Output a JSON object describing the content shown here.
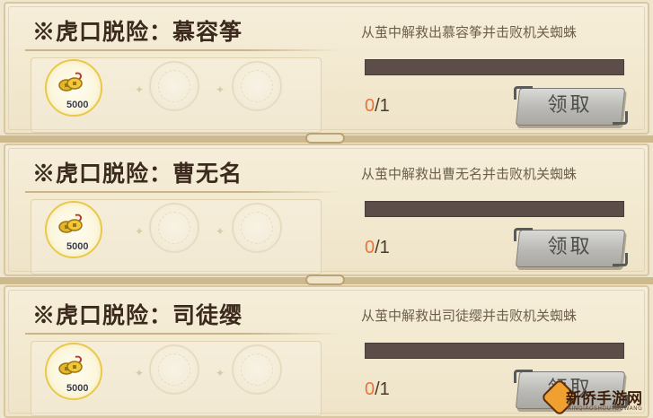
{
  "quests": [
    {
      "title": "※虎口脱险：慕容筝",
      "description": "从茧中解救出慕容筝并击败机关蜘蛛",
      "progress_current": "0",
      "progress_total": "/1",
      "progress_fraction": 0,
      "reward_amount": "5000",
      "claim_label": "领取"
    },
    {
      "title": "※虎口脱险：曹无名",
      "description": "从茧中解救出曹无名并击败机关蜘蛛",
      "progress_current": "0",
      "progress_total": "/1",
      "progress_fraction": 0,
      "reward_amount": "5000",
      "claim_label": "领取"
    },
    {
      "title": "※虎口脱险：司徒缨",
      "description": "从茧中解救出司徒缨并击败机关蜘蛛",
      "progress_current": "0",
      "progress_total": "/1",
      "progress_fraction": 0,
      "reward_amount": "5000",
      "claim_label": "领取"
    }
  ],
  "watermark": {
    "name": "新侨手游网",
    "sub": "XINQIAOSHOUYOUWANG"
  },
  "colors": {
    "background": "#efe6cf",
    "progress_highlight": "#e8743a",
    "bar_track": "#5d4d48",
    "coin_gold": "#e9c84a"
  },
  "icons": {
    "reward": "gold-coins-icon",
    "empty_slot": "empty-reward-slot-icon"
  }
}
